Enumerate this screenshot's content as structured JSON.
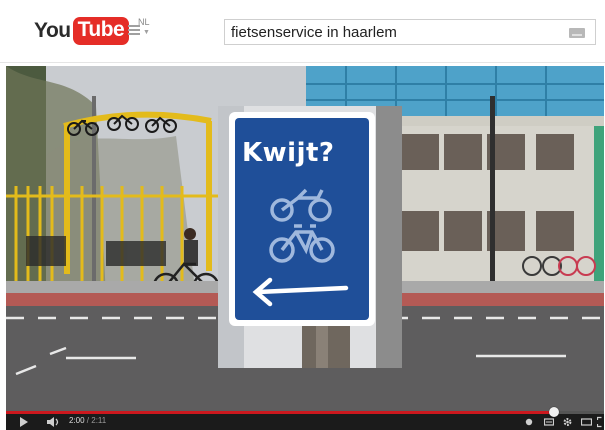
{
  "header": {
    "logo_you": "You",
    "logo_tube": "Tube",
    "region": "NL"
  },
  "search": {
    "query": "fietsenservice in haarlem"
  },
  "video": {
    "sign_text": "Kwijt?"
  },
  "player": {
    "current_time": "2:00",
    "separator": " / ",
    "duration": "2:11",
    "progress": 0.917,
    "colors": {
      "progress": "#cc181e",
      "bar": "#1b1b1b",
      "sign_blue": "#1f4f99"
    },
    "icons": [
      "play-icon",
      "volume-icon",
      "cc-icon",
      "subtitles-icon",
      "gear-icon",
      "theater-icon",
      "fullscreen-icon"
    ]
  }
}
